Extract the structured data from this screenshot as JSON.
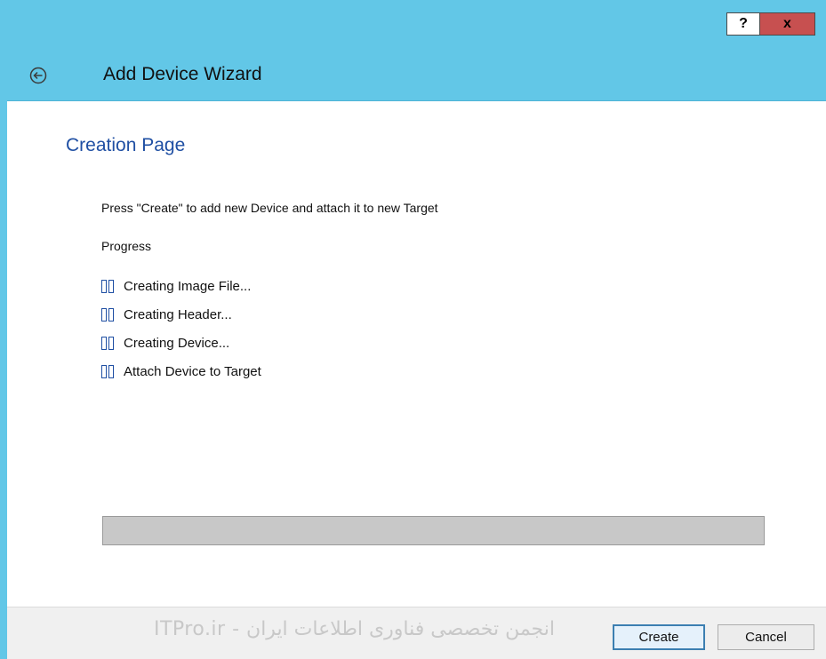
{
  "titlebar": {
    "help_label": "?",
    "close_label": "x"
  },
  "header": {
    "title": "Add Device Wizard"
  },
  "page": {
    "title": "Creation Page",
    "instruction": "Press \"Create\" to add new Device and attach it to new Target",
    "progress_label": "Progress",
    "steps": [
      {
        "label": "Creating Image File..."
      },
      {
        "label": "Creating Header..."
      },
      {
        "label": "Creating Device..."
      },
      {
        "label": "Attach Device to Target"
      }
    ],
    "progress": 0
  },
  "footer": {
    "watermark": "ITPro.ir - انجمن تخصصی فناوری اطلاعات ایران",
    "create_label": "Create",
    "cancel_label": "Cancel"
  },
  "colors": {
    "accent": "#62c7e7",
    "title_blue": "#1f4fa3",
    "close_red": "#c75050"
  }
}
